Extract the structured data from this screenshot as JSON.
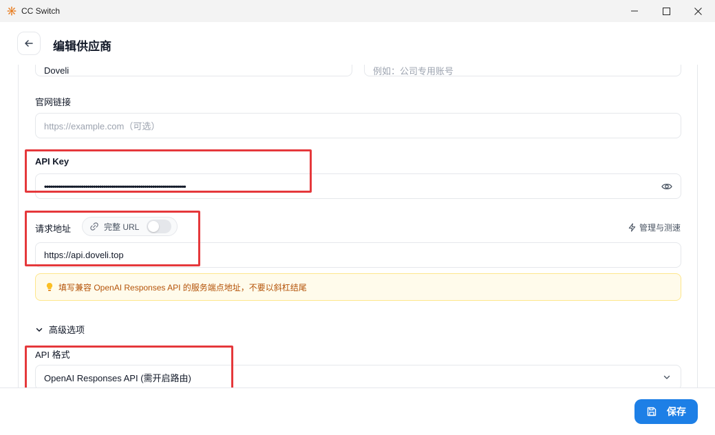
{
  "window": {
    "title": "CC Switch"
  },
  "header": {
    "title": "编辑供应商"
  },
  "form": {
    "name_value": "Doveli",
    "remark_placeholder": "例如：公司专用账号",
    "website": {
      "label": "官网链接",
      "placeholder": "https://example.com（可选）"
    },
    "api_key": {
      "label": "API Key",
      "value": "••••••••••••••••••••••••••••••••••••••••••••••••••••••••••••••••••••••••"
    },
    "endpoint": {
      "label": "请求地址",
      "full_url_toggle_label": "完整 URL",
      "manage_label": "管理与测速",
      "value": "https://api.doveli.top",
      "hint": "填写兼容 OpenAI Responses API 的服务端点地址，不要以斜杠结尾"
    },
    "advanced": {
      "label": "高级选项"
    },
    "api_format": {
      "label": "API 格式",
      "value": "OpenAI Responses API (需开启路由)"
    }
  },
  "footer": {
    "save_label": "保存"
  },
  "colors": {
    "accent": "#1d7fe6",
    "highlight": "#e5383b",
    "hint_bg": "#fffbeb",
    "hint_text": "#b45309"
  }
}
